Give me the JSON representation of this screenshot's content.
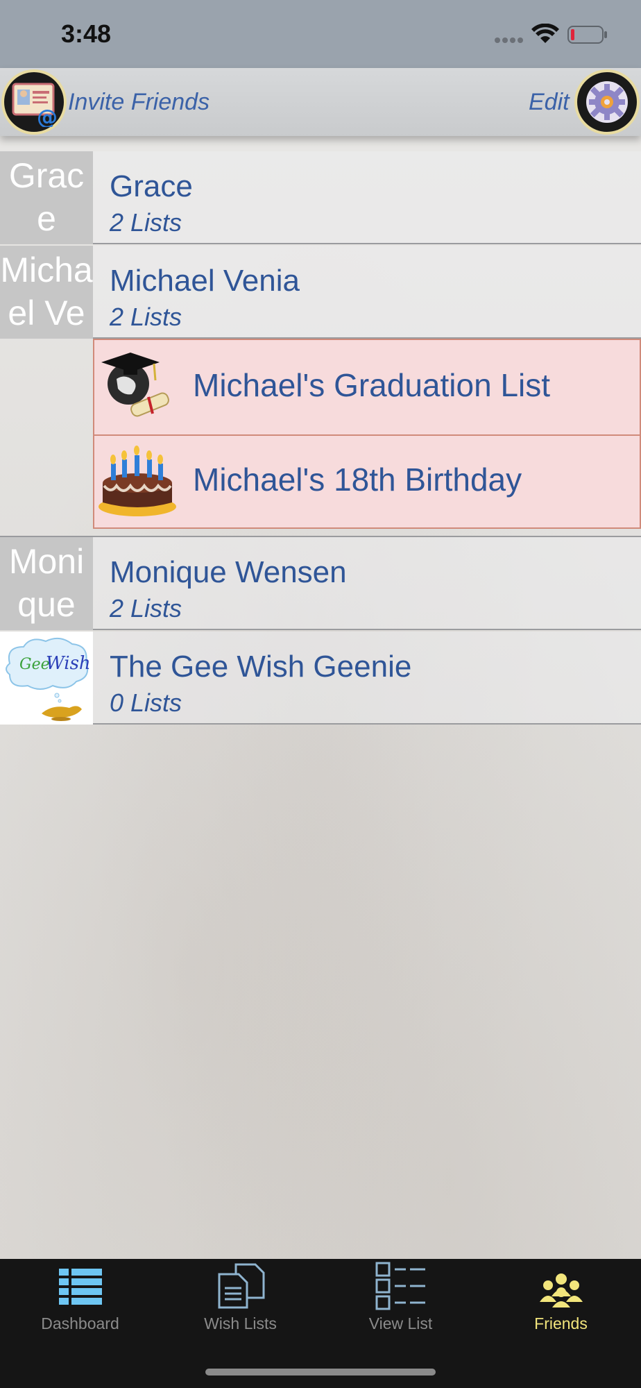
{
  "status_bar": {
    "time": "3:48"
  },
  "header": {
    "invite_label": "Invite Friends",
    "edit_label": "Edit"
  },
  "friends": [
    {
      "avatar_text": "Grace",
      "name": "Grace",
      "count": "2 Lists"
    },
    {
      "avatar_text": "Michael Venia",
      "name": "Michael Venia",
      "count": "2 Lists",
      "lists": [
        {
          "title": "Michael's Graduation List",
          "icon": "graduation-icon"
        },
        {
          "title": "Michael's 18th Birthday",
          "icon": "birthday-cake-icon"
        }
      ]
    },
    {
      "avatar_text": "Monique Wensen",
      "name": "Monique Wensen",
      "count": "2 Lists"
    },
    {
      "avatar_text": "GeeWish",
      "name": "The Gee Wish Geenie",
      "count": "0 Lists"
    }
  ],
  "tabs": [
    {
      "label": "Dashboard",
      "icon": "dashboard-icon",
      "active": false
    },
    {
      "label": "Wish Lists",
      "icon": "wish-lists-icon",
      "active": false
    },
    {
      "label": "View List",
      "icon": "view-list-icon",
      "active": false
    },
    {
      "label": "Friends",
      "icon": "friends-icon",
      "active": true
    }
  ],
  "colors": {
    "accent": "#2f5597",
    "active_tab": "#f2e57c",
    "sublist_bg": "#f7dbdc"
  }
}
